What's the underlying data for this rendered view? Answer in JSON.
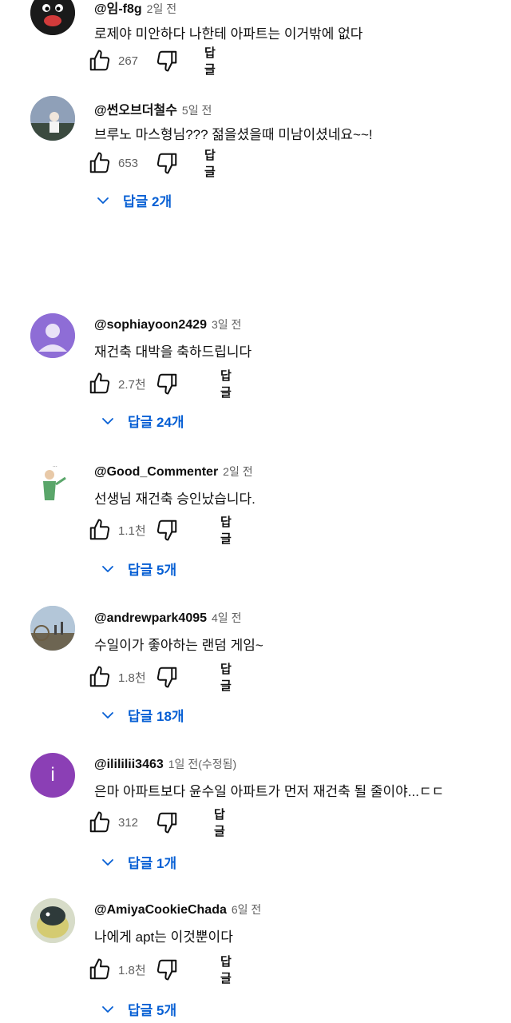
{
  "comments": [
    {
      "handle": "@임-f8g",
      "time": "2일 전",
      "text": "로제야 미안하다 나한테 아파트는 이거밖에 없다",
      "likes": "267",
      "reply": "답글"
    },
    {
      "handle": "@썬오브더철수",
      "time": "5일 전",
      "text": "브루노 마스형님??? 젊을셨을때 미남이셨네요~~!",
      "likes": "653",
      "reply": "답글",
      "replies": "답글 2개"
    },
    {
      "handle": "@sophiayoon2429",
      "time": "3일 전",
      "text": "재건축 대박을 축하드립니다",
      "likes": "2.7천",
      "reply": "답글",
      "replies": "답글 24개"
    },
    {
      "handle": "@Good_Commenter",
      "time": "2일 전",
      "text": "선생님 재건축 승인났습니다.",
      "likes": "1.1천",
      "reply": "답글",
      "replies": "답글 5개"
    },
    {
      "handle": "@andrewpark4095",
      "time": "4일 전",
      "text": "수일이가 좋아하는 랜덤 게임~",
      "likes": "1.8천",
      "reply": "답글",
      "replies": "답글 18개"
    },
    {
      "handle": "@ilililii3463",
      "time": "1일 전(수정됨)",
      "text": "은마 아파트보다 윤수일 아파트가 먼저 재건축 될 줄이야...ㄷㄷ",
      "likes": "312",
      "reply": "답글",
      "replies": "답글 1개",
      "avatar_letter": "i"
    },
    {
      "handle": "@AmiyaCookieChada",
      "time": "6일 전",
      "text": "나에게 apt는 이것뿐이다",
      "likes": "1.8천",
      "reply": "답글",
      "replies": "답글 5개"
    }
  ],
  "colors": {
    "link": "#065fd4",
    "meta": "#606060",
    "purple_avatar": "#8b3fb5",
    "default_avatar": "#8e6dd6"
  },
  "icons": [
    "thumbs-up-icon",
    "thumbs-down-icon",
    "chevron-down-icon"
  ]
}
